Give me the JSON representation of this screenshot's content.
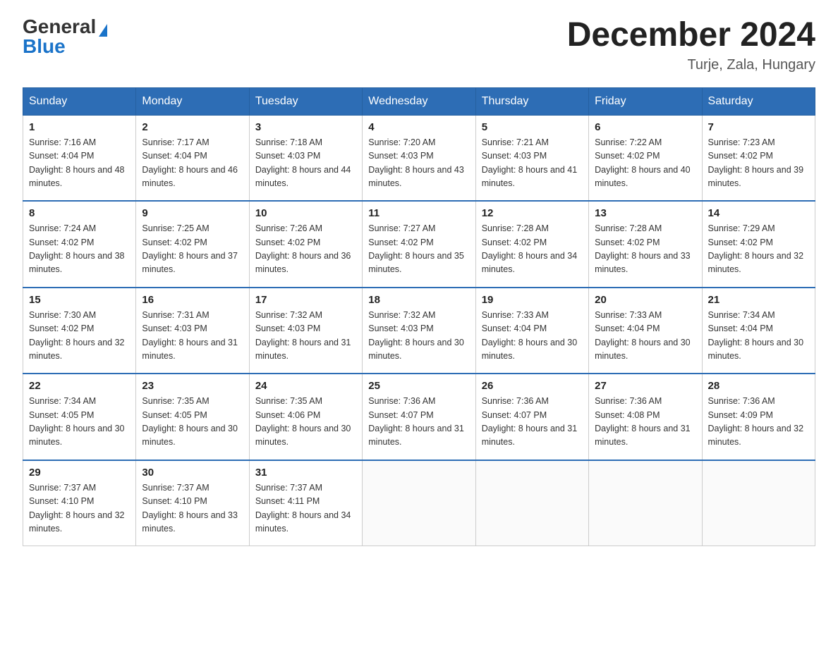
{
  "header": {
    "logo_general": "General",
    "logo_blue": "Blue",
    "month_title": "December 2024",
    "location": "Turje, Zala, Hungary"
  },
  "days_of_week": [
    "Sunday",
    "Monday",
    "Tuesday",
    "Wednesday",
    "Thursday",
    "Friday",
    "Saturday"
  ],
  "weeks": [
    [
      {
        "day": "1",
        "sunrise": "7:16 AM",
        "sunset": "4:04 PM",
        "daylight": "8 hours and 48 minutes."
      },
      {
        "day": "2",
        "sunrise": "7:17 AM",
        "sunset": "4:04 PM",
        "daylight": "8 hours and 46 minutes."
      },
      {
        "day": "3",
        "sunrise": "7:18 AM",
        "sunset": "4:03 PM",
        "daylight": "8 hours and 44 minutes."
      },
      {
        "day": "4",
        "sunrise": "7:20 AM",
        "sunset": "4:03 PM",
        "daylight": "8 hours and 43 minutes."
      },
      {
        "day": "5",
        "sunrise": "7:21 AM",
        "sunset": "4:03 PM",
        "daylight": "8 hours and 41 minutes."
      },
      {
        "day": "6",
        "sunrise": "7:22 AM",
        "sunset": "4:02 PM",
        "daylight": "8 hours and 40 minutes."
      },
      {
        "day": "7",
        "sunrise": "7:23 AM",
        "sunset": "4:02 PM",
        "daylight": "8 hours and 39 minutes."
      }
    ],
    [
      {
        "day": "8",
        "sunrise": "7:24 AM",
        "sunset": "4:02 PM",
        "daylight": "8 hours and 38 minutes."
      },
      {
        "day": "9",
        "sunrise": "7:25 AM",
        "sunset": "4:02 PM",
        "daylight": "8 hours and 37 minutes."
      },
      {
        "day": "10",
        "sunrise": "7:26 AM",
        "sunset": "4:02 PM",
        "daylight": "8 hours and 36 minutes."
      },
      {
        "day": "11",
        "sunrise": "7:27 AM",
        "sunset": "4:02 PM",
        "daylight": "8 hours and 35 minutes."
      },
      {
        "day": "12",
        "sunrise": "7:28 AM",
        "sunset": "4:02 PM",
        "daylight": "8 hours and 34 minutes."
      },
      {
        "day": "13",
        "sunrise": "7:28 AM",
        "sunset": "4:02 PM",
        "daylight": "8 hours and 33 minutes."
      },
      {
        "day": "14",
        "sunrise": "7:29 AM",
        "sunset": "4:02 PM",
        "daylight": "8 hours and 32 minutes."
      }
    ],
    [
      {
        "day": "15",
        "sunrise": "7:30 AM",
        "sunset": "4:02 PM",
        "daylight": "8 hours and 32 minutes."
      },
      {
        "day": "16",
        "sunrise": "7:31 AM",
        "sunset": "4:03 PM",
        "daylight": "8 hours and 31 minutes."
      },
      {
        "day": "17",
        "sunrise": "7:32 AM",
        "sunset": "4:03 PM",
        "daylight": "8 hours and 31 minutes."
      },
      {
        "day": "18",
        "sunrise": "7:32 AM",
        "sunset": "4:03 PM",
        "daylight": "8 hours and 30 minutes."
      },
      {
        "day": "19",
        "sunrise": "7:33 AM",
        "sunset": "4:04 PM",
        "daylight": "8 hours and 30 minutes."
      },
      {
        "day": "20",
        "sunrise": "7:33 AM",
        "sunset": "4:04 PM",
        "daylight": "8 hours and 30 minutes."
      },
      {
        "day": "21",
        "sunrise": "7:34 AM",
        "sunset": "4:04 PM",
        "daylight": "8 hours and 30 minutes."
      }
    ],
    [
      {
        "day": "22",
        "sunrise": "7:34 AM",
        "sunset": "4:05 PM",
        "daylight": "8 hours and 30 minutes."
      },
      {
        "day": "23",
        "sunrise": "7:35 AM",
        "sunset": "4:05 PM",
        "daylight": "8 hours and 30 minutes."
      },
      {
        "day": "24",
        "sunrise": "7:35 AM",
        "sunset": "4:06 PM",
        "daylight": "8 hours and 30 minutes."
      },
      {
        "day": "25",
        "sunrise": "7:36 AM",
        "sunset": "4:07 PM",
        "daylight": "8 hours and 31 minutes."
      },
      {
        "day": "26",
        "sunrise": "7:36 AM",
        "sunset": "4:07 PM",
        "daylight": "8 hours and 31 minutes."
      },
      {
        "day": "27",
        "sunrise": "7:36 AM",
        "sunset": "4:08 PM",
        "daylight": "8 hours and 31 minutes."
      },
      {
        "day": "28",
        "sunrise": "7:36 AM",
        "sunset": "4:09 PM",
        "daylight": "8 hours and 32 minutes."
      }
    ],
    [
      {
        "day": "29",
        "sunrise": "7:37 AM",
        "sunset": "4:10 PM",
        "daylight": "8 hours and 32 minutes."
      },
      {
        "day": "30",
        "sunrise": "7:37 AM",
        "sunset": "4:10 PM",
        "daylight": "8 hours and 33 minutes."
      },
      {
        "day": "31",
        "sunrise": "7:37 AM",
        "sunset": "4:11 PM",
        "daylight": "8 hours and 34 minutes."
      },
      null,
      null,
      null,
      null
    ]
  ]
}
